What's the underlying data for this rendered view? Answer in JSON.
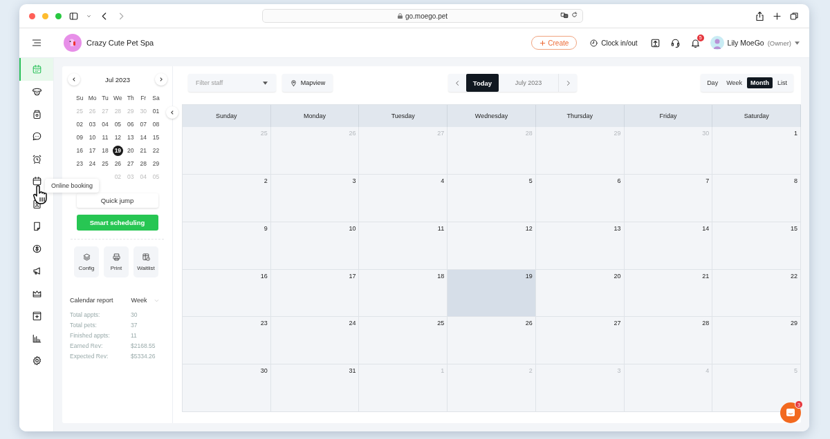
{
  "browser": {
    "url": "go.moego.pet"
  },
  "header": {
    "business": "Crazy Cute Pet Spa",
    "create": "Create",
    "clock": "Clock in/out",
    "notifications": "5",
    "user": "Lily MoeGo",
    "role": "(Owner)"
  },
  "nav": [
    {
      "kind": "calendar",
      "selected": true
    },
    {
      "kind": "dog",
      "selected": false
    },
    {
      "kind": "jar",
      "selected": false
    },
    {
      "kind": "chat",
      "selected": false
    },
    {
      "kind": "alarm",
      "selected": false
    },
    {
      "kind": "booking",
      "selected": false
    },
    {
      "kind": "contact",
      "selected": false
    },
    {
      "kind": "note",
      "selected": false
    },
    {
      "kind": "dollar",
      "selected": false
    },
    {
      "kind": "megaphone",
      "selected": false
    },
    {
      "kind": "crown",
      "selected": false
    },
    {
      "kind": "plus-calendar",
      "selected": false
    },
    {
      "kind": "chart",
      "selected": false
    },
    {
      "kind": "settings",
      "selected": false
    }
  ],
  "tooltip": "Online booking",
  "mini_calendar": {
    "title": "Jul 2023",
    "weekdays": [
      "Su",
      "Mo",
      "Tu",
      "We",
      "Th",
      "Fr",
      "Sa"
    ],
    "weeks": [
      [
        {
          "day": "25",
          "muted": true,
          "selected": false
        },
        {
          "day": "26",
          "muted": true,
          "selected": false
        },
        {
          "day": "27",
          "muted": true,
          "selected": false
        },
        {
          "day": "28",
          "muted": true,
          "selected": false
        },
        {
          "day": "29",
          "muted": true,
          "selected": false
        },
        {
          "day": "30",
          "muted": true,
          "selected": false
        },
        {
          "day": "01",
          "muted": false,
          "selected": false
        }
      ],
      [
        {
          "day": "02",
          "muted": false,
          "selected": false
        },
        {
          "day": "03",
          "muted": false,
          "selected": false
        },
        {
          "day": "04",
          "muted": false,
          "selected": false
        },
        {
          "day": "05",
          "muted": false,
          "selected": false
        },
        {
          "day": "06",
          "muted": false,
          "selected": false
        },
        {
          "day": "07",
          "muted": false,
          "selected": false
        },
        {
          "day": "08",
          "muted": false,
          "selected": false
        }
      ],
      [
        {
          "day": "09",
          "muted": false,
          "selected": false
        },
        {
          "day": "10",
          "muted": false,
          "selected": false
        },
        {
          "day": "11",
          "muted": false,
          "selected": false
        },
        {
          "day": "12",
          "muted": false,
          "selected": false
        },
        {
          "day": "13",
          "muted": false,
          "selected": false
        },
        {
          "day": "14",
          "muted": false,
          "selected": false
        },
        {
          "day": "15",
          "muted": false,
          "selected": false
        }
      ],
      [
        {
          "day": "16",
          "muted": false,
          "selected": false
        },
        {
          "day": "17",
          "muted": false,
          "selected": false
        },
        {
          "day": "18",
          "muted": false,
          "selected": false
        },
        {
          "day": "19",
          "muted": false,
          "selected": true
        },
        {
          "day": "20",
          "muted": false,
          "selected": false
        },
        {
          "day": "21",
          "muted": false,
          "selected": false
        },
        {
          "day": "22",
          "muted": false,
          "selected": false
        }
      ],
      [
        {
          "day": "23",
          "muted": false,
          "selected": false
        },
        {
          "day": "24",
          "muted": false,
          "selected": false
        },
        {
          "day": "25",
          "muted": false,
          "selected": false
        },
        {
          "day": "26",
          "muted": false,
          "selected": false
        },
        {
          "day": "27",
          "muted": false,
          "selected": false
        },
        {
          "day": "28",
          "muted": false,
          "selected": false
        },
        {
          "day": "29",
          "muted": false,
          "selected": false
        }
      ],
      [
        {
          "day": "02",
          "muted": true,
          "selected": false
        },
        {
          "day": "03",
          "muted": true,
          "selected": false
        },
        {
          "day": "04",
          "muted": true,
          "selected": false
        },
        {
          "day": "05",
          "muted": true,
          "selected": false
        }
      ]
    ]
  },
  "quick_jump": "Quick jump",
  "smart_scheduling": "Smart scheduling",
  "tools": [
    {
      "kind": "layers",
      "label": "Config"
    },
    {
      "kind": "printer",
      "label": "Print"
    },
    {
      "kind": "waitlist",
      "label": "Waitlist"
    }
  ],
  "report": {
    "title": "Calendar report",
    "period": "Week",
    "stats": [
      {
        "label": "Total appts:",
        "value": "30"
      },
      {
        "label": "Total pets:",
        "value": "37"
      },
      {
        "label": "Finished appts:",
        "value": "11"
      },
      {
        "label": "Earned Rev:",
        "value": "$2168.55"
      },
      {
        "label": "Expected Rev:",
        "value": "$5334.26"
      }
    ]
  },
  "toolbar": {
    "filter_placeholder": "Filter staff",
    "mapview": "Mapview",
    "today": "Today",
    "period": "July 2023",
    "views": [
      {
        "label": "Day",
        "selected": false
      },
      {
        "label": "Week",
        "selected": false
      },
      {
        "label": "Month",
        "selected": true
      },
      {
        "label": "List",
        "selected": false
      }
    ]
  },
  "calendar": {
    "weekdays": [
      "Sunday",
      "Monday",
      "Tuesday",
      "Wednesday",
      "Thursday",
      "Friday",
      "Saturday"
    ],
    "weeks": [
      [
        {
          "day": "25",
          "muted": true,
          "today": false
        },
        {
          "day": "26",
          "muted": true,
          "today": false
        },
        {
          "day": "27",
          "muted": true,
          "today": false
        },
        {
          "day": "28",
          "muted": true,
          "today": false
        },
        {
          "day": "29",
          "muted": true,
          "today": false
        },
        {
          "day": "30",
          "muted": true,
          "today": false
        },
        {
          "day": "1",
          "muted": false,
          "today": false
        }
      ],
      [
        {
          "day": "2",
          "muted": false,
          "today": false
        },
        {
          "day": "3",
          "muted": false,
          "today": false
        },
        {
          "day": "4",
          "muted": false,
          "today": false
        },
        {
          "day": "5",
          "muted": false,
          "today": false
        },
        {
          "day": "6",
          "muted": false,
          "today": false
        },
        {
          "day": "7",
          "muted": false,
          "today": false
        },
        {
          "day": "8",
          "muted": false,
          "today": false
        }
      ],
      [
        {
          "day": "9",
          "muted": false,
          "today": false
        },
        {
          "day": "10",
          "muted": false,
          "today": false
        },
        {
          "day": "11",
          "muted": false,
          "today": false
        },
        {
          "day": "12",
          "muted": false,
          "today": false
        },
        {
          "day": "13",
          "muted": false,
          "today": false
        },
        {
          "day": "14",
          "muted": false,
          "today": false
        },
        {
          "day": "15",
          "muted": false,
          "today": false
        }
      ],
      [
        {
          "day": "16",
          "muted": false,
          "today": false
        },
        {
          "day": "17",
          "muted": false,
          "today": false
        },
        {
          "day": "18",
          "muted": false,
          "today": false
        },
        {
          "day": "19",
          "muted": false,
          "today": true
        },
        {
          "day": "20",
          "muted": false,
          "today": false
        },
        {
          "day": "21",
          "muted": false,
          "today": false
        },
        {
          "day": "22",
          "muted": false,
          "today": false
        }
      ],
      [
        {
          "day": "23",
          "muted": false,
          "today": false
        },
        {
          "day": "24",
          "muted": false,
          "today": false
        },
        {
          "day": "25",
          "muted": false,
          "today": false
        },
        {
          "day": "26",
          "muted": false,
          "today": false
        },
        {
          "day": "27",
          "muted": false,
          "today": false
        },
        {
          "day": "28",
          "muted": false,
          "today": false
        },
        {
          "day": "29",
          "muted": false,
          "today": false
        }
      ],
      [
        {
          "day": "30",
          "muted": false,
          "today": false
        },
        {
          "day": "31",
          "muted": false,
          "today": false
        },
        {
          "day": "1",
          "muted": true,
          "today": false
        },
        {
          "day": "2",
          "muted": true,
          "today": false
        },
        {
          "day": "3",
          "muted": true,
          "today": false
        },
        {
          "day": "4",
          "muted": true,
          "today": false
        },
        {
          "day": "5",
          "muted": true,
          "today": false
        }
      ]
    ]
  },
  "chat": {
    "badge": "3"
  }
}
